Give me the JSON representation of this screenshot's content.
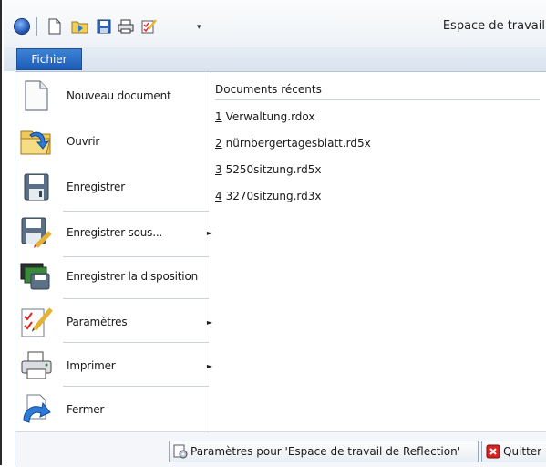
{
  "window": {
    "title": "Espace de travail"
  },
  "tabs": {
    "file_label": "Fichier"
  },
  "menu": {
    "items": [
      {
        "label": "Nouveau document",
        "icon": "new-document-icon",
        "has_submenu": false
      },
      {
        "label": "Ouvrir",
        "icon": "open-folder-icon",
        "has_submenu": false
      },
      {
        "label": "Enregistrer",
        "icon": "save-icon",
        "has_submenu": false
      },
      {
        "label": "Enregistrer sous...",
        "icon": "save-as-icon",
        "has_submenu": true
      },
      {
        "label": "Enregistrer la disposition",
        "icon": "save-layout-icon",
        "has_submenu": false
      },
      {
        "label": "Paramètres",
        "icon": "settings-icon",
        "has_submenu": true
      },
      {
        "label": "Imprimer",
        "icon": "printer-icon",
        "has_submenu": true
      },
      {
        "label": "Fermer",
        "icon": "close-document-icon",
        "has_submenu": false
      }
    ]
  },
  "recent": {
    "heading": "Documents récents",
    "items": [
      {
        "num": "1",
        "name": "Verwaltung.rdox"
      },
      {
        "num": "2",
        "name": "nürnbergertagesblatt.rd5x"
      },
      {
        "num": "3",
        "name": "5250sitzung.rd5x"
      },
      {
        "num": "4",
        "name": "3270sitzung.rd3x"
      }
    ]
  },
  "footer": {
    "settings_label": "Paramètres pour 'Espace de travail de Reflection'",
    "quit_label": "Quitter"
  }
}
